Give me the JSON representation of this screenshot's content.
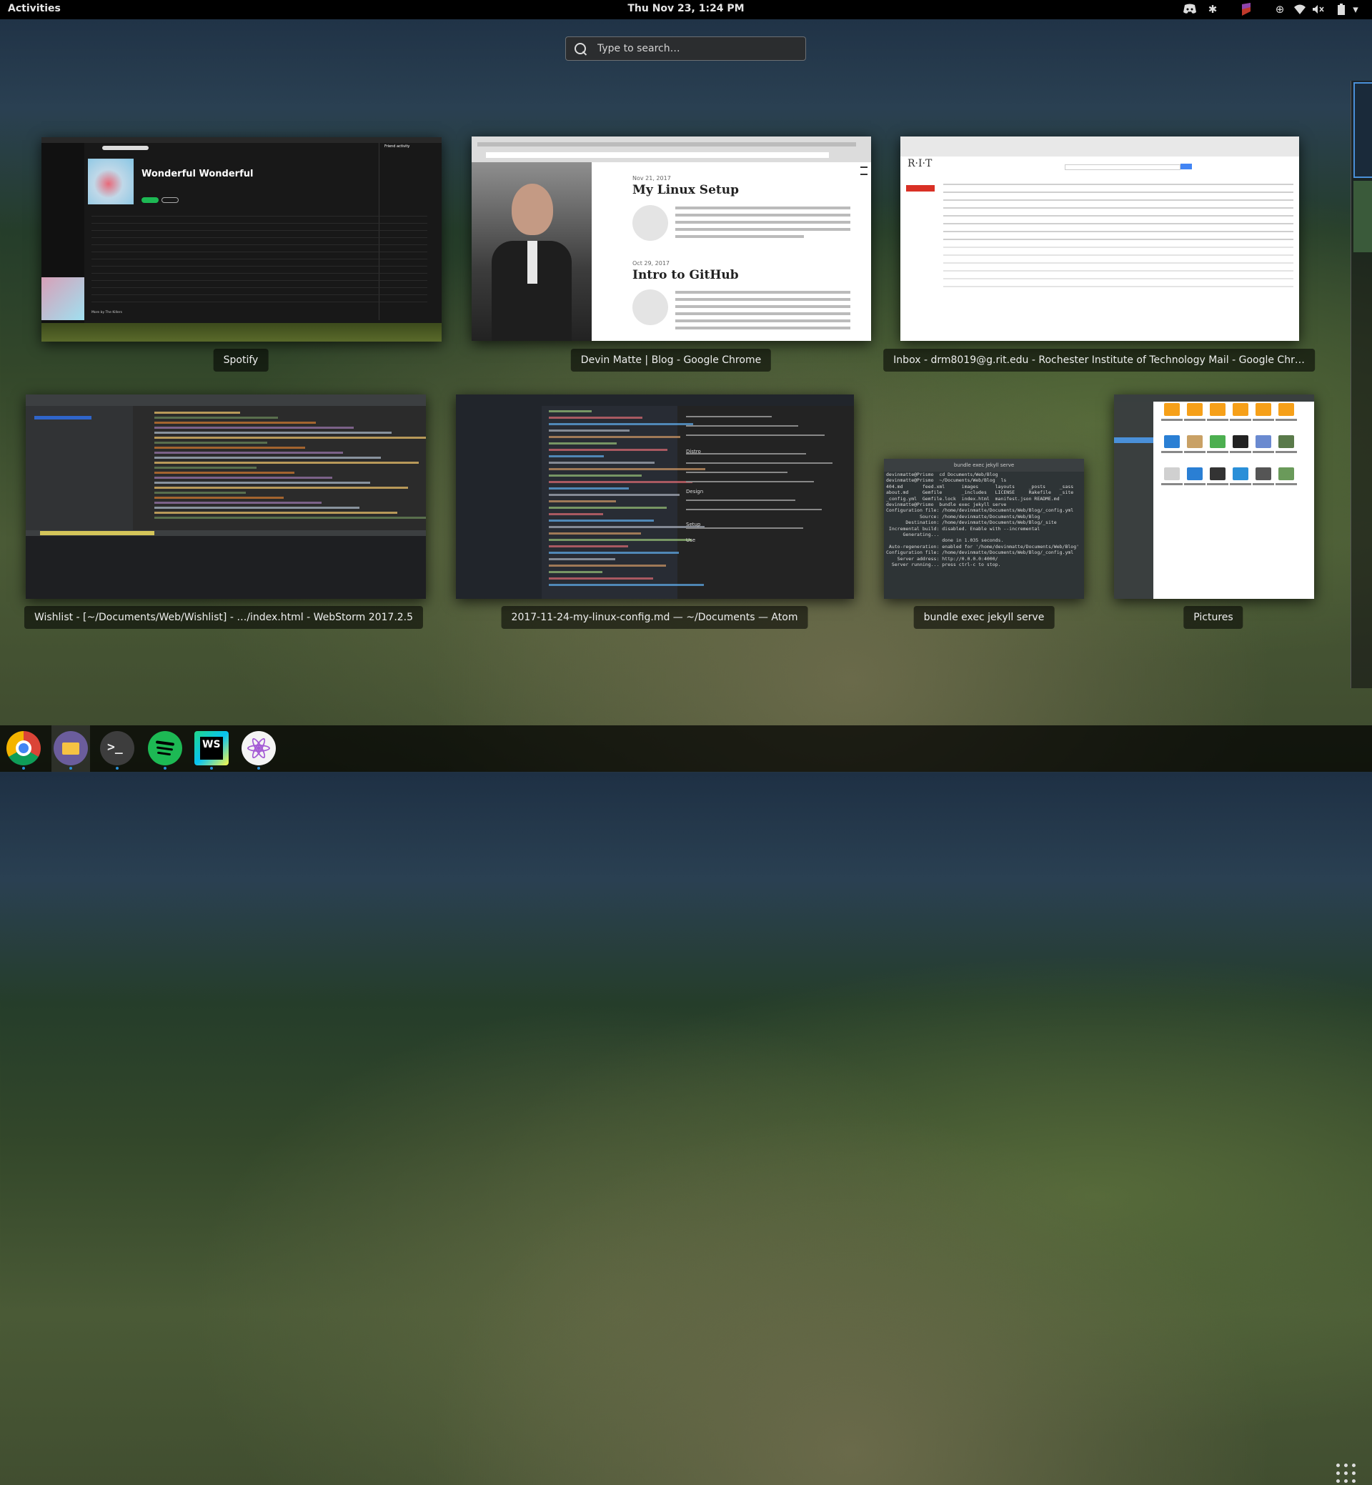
{
  "topbar": {
    "activities": "Activities",
    "clock": "Thu Nov 23,  1:24 PM",
    "tray_icons": [
      "discord-icon",
      "settings-sprocket-icon",
      "slack-icon",
      "accessibility-icon",
      "wifi-icon",
      "volume-muted-icon",
      "battery-icon",
      "power-menu-icon"
    ]
  },
  "search": {
    "placeholder": "Type to search…"
  },
  "windows": {
    "spotify": {
      "caption": "Spotify",
      "album": "Wonderful Wonderful",
      "friend_activity": "Friend activity",
      "more_by": "More by The Killers"
    },
    "blog": {
      "caption": "Devin Matte | Blog - Google Chrome",
      "post1_date": "Nov 21, 2017",
      "post1_title": "My Linux Setup",
      "post2_date": "Oct 29, 2017",
      "post2_title": "Intro to GitHub"
    },
    "mail": {
      "caption": "Inbox - drm8019@g.rit.edu - Rochester Institute of Technology Mail - Google Chr…",
      "logo": "R·I·T"
    },
    "webstorm": {
      "caption": "Wishlist - [~/Documents/Web/Wishlist] - …/index.html - WebStorm 2017.2.5"
    },
    "atom": {
      "caption": "2017-11-24-my-linux-config.md — ~/Documents — Atom",
      "preview_headings": [
        "Distro",
        "Design",
        "Setup",
        "Use"
      ]
    },
    "terminal": {
      "caption": "bundle exec jekyll serve",
      "title": "bundle exec jekyll serve",
      "lines": [
        "devinmatte@Prismo  cd Documents/Web/Blog",
        "devinmatte@Prismo  ~/Documents/Web/Blog  ls",
        "404.md       feed.xml      images      layouts     _posts     _sass",
        "about.md     Gemfile       _includes   LICENSE     Rakefile   _site",
        "_config.yml  Gemfile.lock  index.html  manifest.json README.md",
        "devinmatte@Prismo  bundle exec jekyll serve",
        "Configuration file: /home/devinmatte/Documents/Web/Blog/_config.yml",
        "            Source: /home/devinmatte/Documents/Web/Blog",
        "       Destination: /home/devinmatte/Documents/Web/Blog/_site",
        " Incremental build: disabled. Enable with --incremental",
        "      Generating...",
        "                    done in 1.035 seconds.",
        " Auto-regeneration: enabled for '/home/devinmatte/Documents/Web/Blog'",
        "Configuration file: /home/devinmatte/Documents/Web/Blog/_config.yml",
        "    Server address: http://0.0.0.0:4000/",
        "  Server running... press ctrl-c to stop."
      ]
    },
    "files": {
      "caption": "Pictures"
    }
  },
  "dock": {
    "apps": [
      "Google Chrome",
      "Files",
      "Terminal",
      "Spotify",
      "WebStorm",
      "Atom"
    ]
  }
}
